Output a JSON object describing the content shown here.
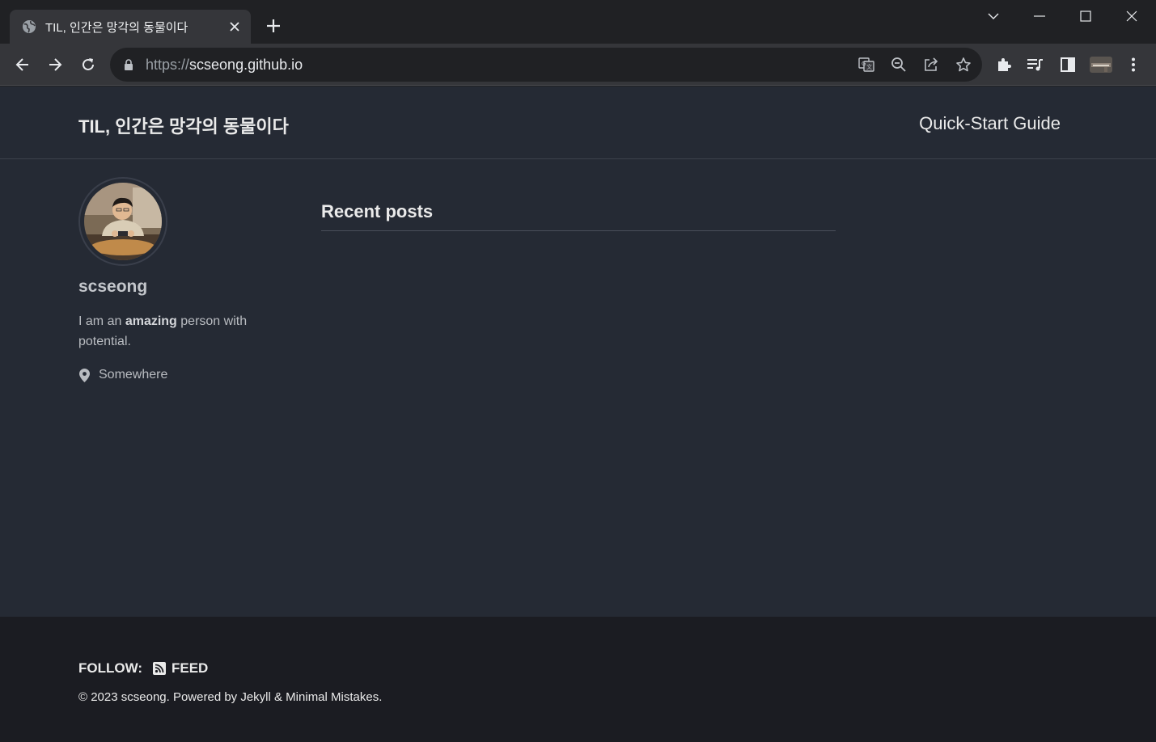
{
  "browser": {
    "tab": {
      "title": "TIL, 인간은 망각의 동물이다",
      "favicon": "globe-icon"
    },
    "address_bar": {
      "scheme": "https://",
      "host": "scseong.github.io"
    },
    "window_controls": [
      "chevron-down-icon",
      "minimize-icon",
      "maximize-icon",
      "close-icon"
    ],
    "toolbar_icons": [
      "translate-icon",
      "zoom-out-icon",
      "share-icon",
      "star-icon",
      "extensions-icon",
      "media-icon",
      "side-panel-icon",
      "profile-avatar",
      "menu-icon"
    ]
  },
  "site": {
    "title": "TIL, 인간은 망각의 동물이다",
    "nav": {
      "link": "Quick-Start Guide"
    }
  },
  "author": {
    "name": "scseong",
    "bio_prefix": "I am an ",
    "bio_bold": "amazing",
    "bio_suffix": " person with potential.",
    "location": "Somewhere"
  },
  "main": {
    "section_title": "Recent posts",
    "posts": []
  },
  "footer": {
    "follow_label": "FOLLOW:",
    "feed_label": "FEED",
    "copyright": "© 2023 scseong. Powered by Jekyll & Minimal Mistakes."
  },
  "colors": {
    "page_background": "#252a34",
    "footer_background": "#1b1c22",
    "chrome_background": "#202124",
    "chrome_toolbar": "#35363a",
    "text": "#eaeaea"
  }
}
